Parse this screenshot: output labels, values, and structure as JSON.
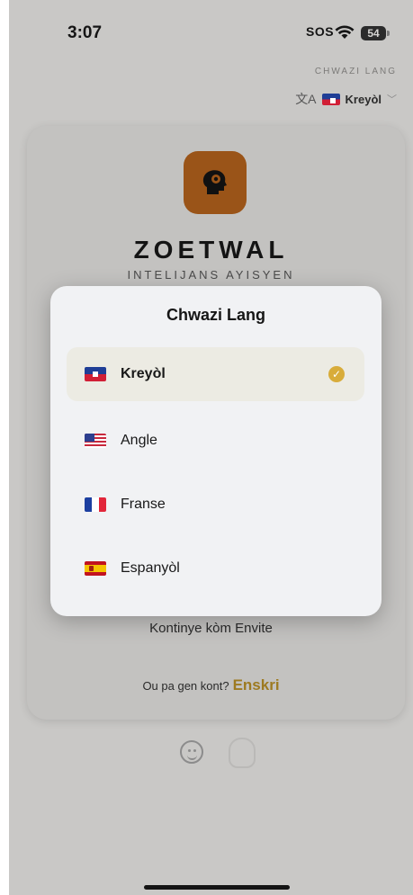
{
  "status_bar": {
    "time": "3:07",
    "sos": "SOS",
    "battery": "54"
  },
  "language_header": {
    "caption": "CHWAZI LANG",
    "current": "Kreyòl",
    "current_flag": "haiti-flag-icon"
  },
  "brand": {
    "name": "ZOETWAL",
    "tagline": "INTELIJANS AYISYEN",
    "accent_color": "#9a5418"
  },
  "actions": {
    "guest_label": "Kontinye kòm Envite",
    "signup_prompt": "Ou pa gen kont?",
    "signup_link": "Enskri"
  },
  "modal": {
    "title": "Chwazi Lang",
    "options": [
      {
        "label": "Kreyòl",
        "flag": "haiti-flag-icon",
        "selected": true
      },
      {
        "label": "Angle",
        "flag": "usa-flag-icon",
        "selected": false
      },
      {
        "label": "Franse",
        "flag": "france-flag-icon",
        "selected": false
      },
      {
        "label": "Espanyòl",
        "flag": "spain-flag-icon",
        "selected": false
      }
    ],
    "selected_color": "#d8ac3a"
  }
}
